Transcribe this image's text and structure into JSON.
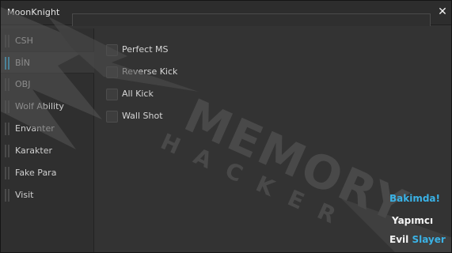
{
  "window": {
    "title": "MoonKnight",
    "close_glyph": "✕"
  },
  "sidebar": {
    "items": [
      {
        "label": "CSH",
        "active": false
      },
      {
        "label": "BİN",
        "active": true
      },
      {
        "label": "OBJ",
        "active": false
      },
      {
        "label": "Wolf Ability",
        "active": false
      },
      {
        "label": "Envanter",
        "active": false
      },
      {
        "label": "Karakter",
        "active": false
      },
      {
        "label": "Fake Para",
        "active": false
      },
      {
        "label": "Visit",
        "active": false
      }
    ]
  },
  "options": [
    {
      "label": "Perfect MS",
      "checked": false
    },
    {
      "label": "Reverse Kick",
      "checked": false
    },
    {
      "label": "All Kick",
      "checked": false
    },
    {
      "label": "Wall Shot",
      "checked": false
    }
  ],
  "watermark": {
    "word1": "MEMORY",
    "word2": "HACKER",
    "icon": "watermark-logo"
  },
  "footer": {
    "status": "Bakimda!",
    "credit_label": "Yapımcı",
    "author_part1": "Evil",
    "author_part2": "Slayer"
  },
  "colors": {
    "accent": "#3fb7e8",
    "background": "#333333",
    "sidebar": "#2f2f2f"
  }
}
